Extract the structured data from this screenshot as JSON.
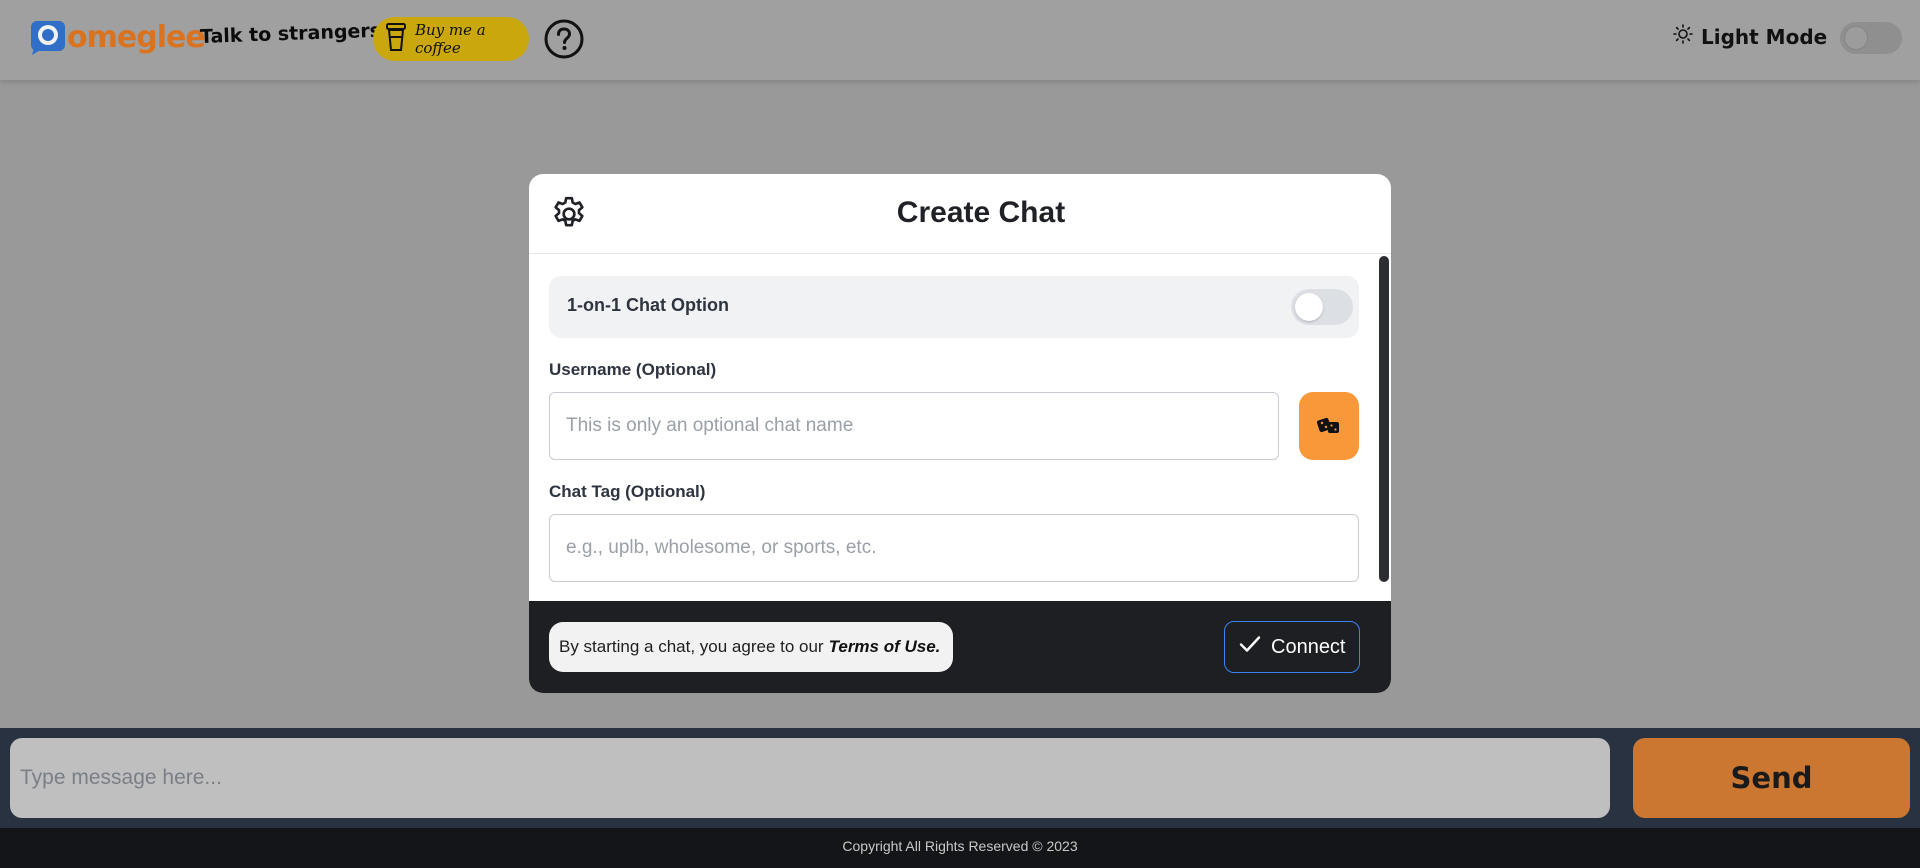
{
  "header": {
    "logo_text": "omeglee",
    "tagline": "Talk to strangers!",
    "coffee_label": "Buy me a coffee",
    "help_icon": "question-circle-icon",
    "mode_label": "Light Mode",
    "mode_icon": "sun-icon",
    "mode_enabled": false
  },
  "modal": {
    "title": "Create Chat",
    "settings_icon": "gear-icon",
    "chat_option": {
      "label": "1-on-1 Chat Option",
      "enabled": false
    },
    "username": {
      "label": "Username (Optional)",
      "placeholder": "This is only an optional chat name",
      "value": ""
    },
    "randomize_icon": "dice-icon",
    "chat_tag": {
      "label": "Chat Tag (Optional)",
      "placeholder": "e.g., uplb, wholesome, or sports, etc.",
      "value": ""
    },
    "terms_text": "By starting a chat, you agree to our",
    "terms_link": "Terms of Use.",
    "connect_label": "Connect",
    "connect_icon": "check-icon"
  },
  "composer": {
    "placeholder": "Type message here...",
    "send_label": "Send"
  },
  "footer": {
    "copyright": "Copyright All Rights Reserved © 2023"
  },
  "colors": {
    "brand_orange": "#d9731f",
    "accent_orange": "#f99838",
    "coffee_yellow": "#c9a70d",
    "connect_border": "#3b82f6",
    "dark_bar": "#1e1f22"
  }
}
